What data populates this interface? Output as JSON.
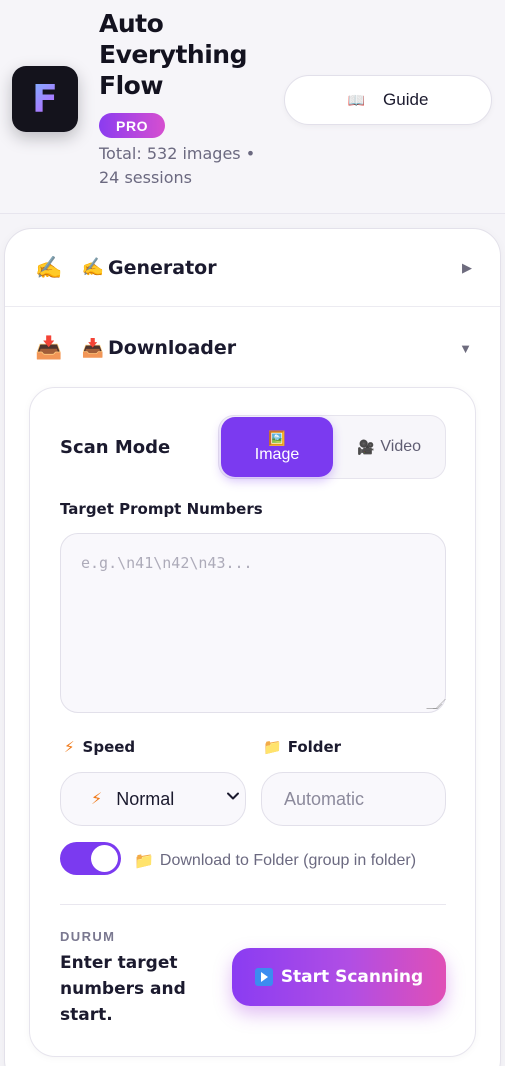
{
  "header": {
    "logo_letter": "F",
    "title": "Auto Everything Flow",
    "badge": "PRO",
    "stats": "Total: 532 images • 24 sessions",
    "guide_icon": "book-icon",
    "guide_label": "Guide"
  },
  "sections": {
    "generator": {
      "icon": "✍️",
      "label": "Generator",
      "expanded": false
    },
    "downloader": {
      "icon": "📥",
      "label": "Downloader",
      "expanded": true
    }
  },
  "downloader": {
    "scan_mode_label": "Scan Mode",
    "modes": {
      "image": "Image",
      "video": "Video",
      "selected": "Image"
    },
    "target_label": "Target Prompt Numbers",
    "target_value": "",
    "target_placeholder": "e.g.\\n41\\n42\\n43...",
    "speed_label": "Speed",
    "speed_value": "Normal",
    "folder_label": "Folder",
    "folder_value": "",
    "folder_placeholder": "Automatic",
    "toggle_on": true,
    "toggle_label": "Download to Folder (group in folder)",
    "status_label": "DURUM",
    "status_text": "Enter target numbers and start.",
    "start_button": "Start Scanning"
  },
  "colors": {
    "accent": "#7b3af0",
    "gradient_end": "#e04fb6"
  }
}
